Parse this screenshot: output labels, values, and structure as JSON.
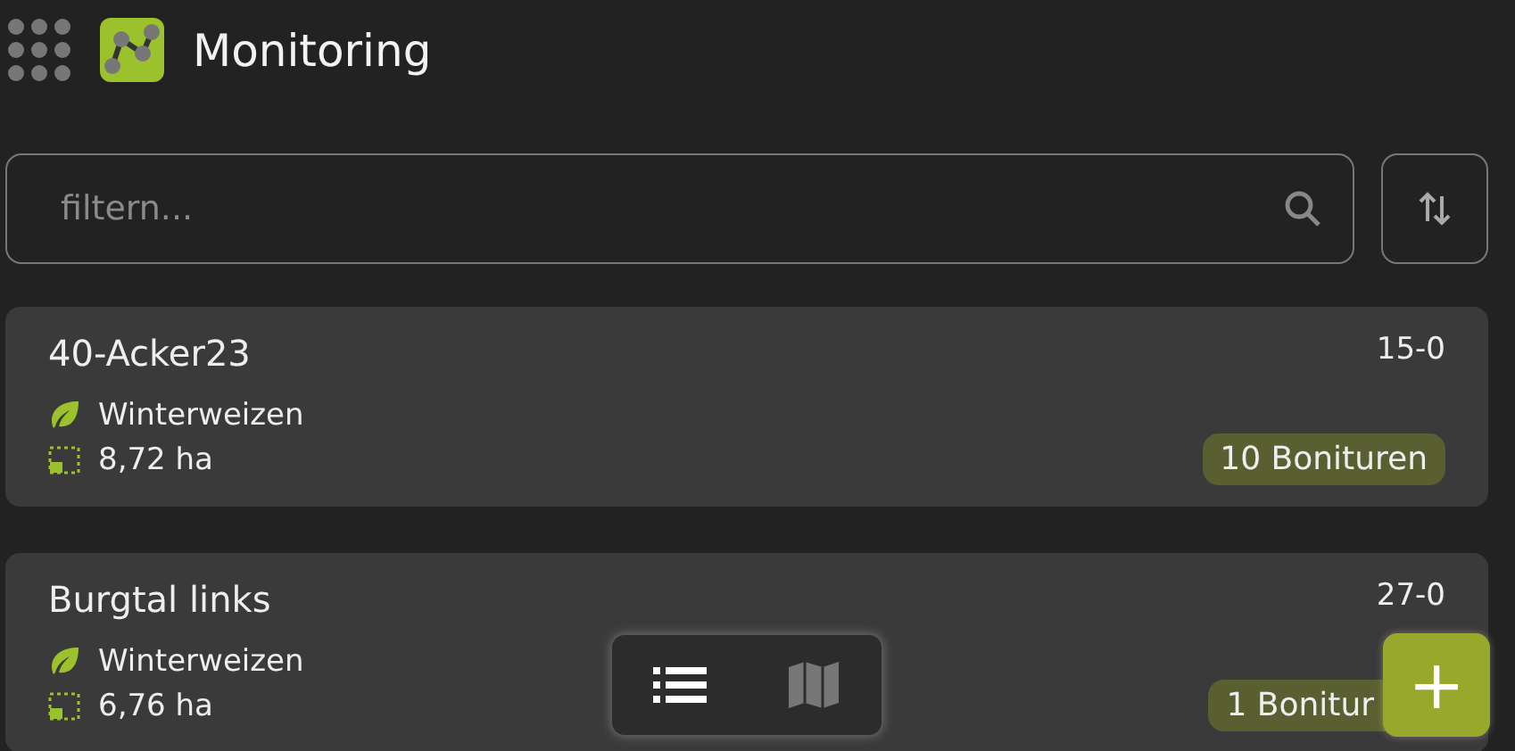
{
  "header": {
    "title": "Monitoring"
  },
  "search": {
    "placeholder": "filtern..."
  },
  "fields": [
    {
      "name": "40-Acker23",
      "code": "15-0",
      "crop": "Winterweizen",
      "area": "8,72 ha",
      "count": "10 Bonituren"
    },
    {
      "name": "Burgtal links",
      "code": "27-0",
      "crop": "Winterweizen",
      "area": "6,76 ha",
      "count": "1 Bonitur"
    }
  ],
  "view_toggle": [
    {
      "kind": "list",
      "selected": true
    },
    {
      "kind": "map",
      "selected": false
    }
  ],
  "add_button": {
    "label": "+"
  }
}
